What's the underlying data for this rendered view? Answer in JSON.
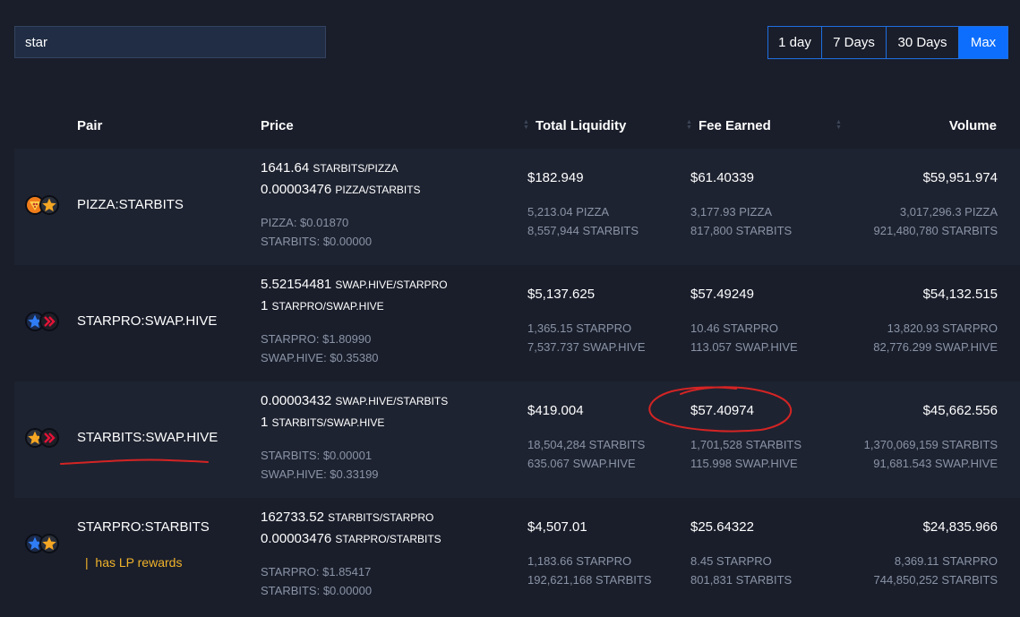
{
  "search": {
    "value": "star"
  },
  "periods": [
    {
      "label": "1 day",
      "active": false
    },
    {
      "label": "7 Days",
      "active": false
    },
    {
      "label": "30 Days",
      "active": false
    },
    {
      "label": "Max",
      "active": true
    }
  ],
  "table": {
    "headers": {
      "pair": "Pair",
      "price": "Price",
      "liquidity": "Total Liquidity",
      "fee": "Fee Earned",
      "volume": "Volume"
    },
    "rows": [
      {
        "pair": "PIZZA:STARBITS",
        "icons": [
          "pizza-token-icon",
          "starbits-token-icon"
        ],
        "lp_rewards": "",
        "price1": {
          "value": "1641.64",
          "unit": "STARBITS/PIZZA"
        },
        "price2": {
          "value": "0.00003476",
          "unit": "PIZZA/STARBITS"
        },
        "usd1": "PIZZA: $0.01870",
        "usd2": "STARBITS: $0.00000",
        "liquidity": "$182.949",
        "liquidity_1": "5,213.04 PIZZA",
        "liquidity_2": "8,557,944 STARBITS",
        "fee": "$61.40339",
        "fee_1": "3,177.93 PIZZA",
        "fee_2": "817,800 STARBITS",
        "volume": "$59,951.974",
        "volume_1": "3,017,296.3 PIZZA",
        "volume_2": "921,480,780 STARBITS"
      },
      {
        "pair": "STARPRO:SWAP.HIVE",
        "icons": [
          "starpro-token-icon",
          "swap-hive-token-icon"
        ],
        "lp_rewards": "",
        "price1": {
          "value": "5.52154481",
          "unit": "SWAP.HIVE/STARPRO"
        },
        "price2": {
          "value": "1",
          "unit": "STARPRO/SWAP.HIVE"
        },
        "usd1": "STARPRO: $1.80990",
        "usd2": "SWAP.HIVE: $0.35380",
        "liquidity": "$5,137.625",
        "liquidity_1": "1,365.15 STARPRO",
        "liquidity_2": "7,537.737 SWAP.HIVE",
        "fee": "$57.49249",
        "fee_1": "10.46 STARPRO",
        "fee_2": "113.057 SWAP.HIVE",
        "volume": "$54,132.515",
        "volume_1": "13,820.93 STARPRO",
        "volume_2": "82,776.299 SWAP.HIVE"
      },
      {
        "pair": "STARBITS:SWAP.HIVE",
        "icons": [
          "starbits-token-icon",
          "swap-hive-token-icon"
        ],
        "lp_rewards": "",
        "price1": {
          "value": "0.00003432",
          "unit": "SWAP.HIVE/STARBITS"
        },
        "price2": {
          "value": "1",
          "unit": "STARBITS/SWAP.HIVE"
        },
        "usd1": "STARBITS: $0.00001",
        "usd2": "SWAP.HIVE: $0.33199",
        "liquidity": "$419.004",
        "liquidity_1": "18,504,284 STARBITS",
        "liquidity_2": "635.067 SWAP.HIVE",
        "fee": "$57.40974",
        "fee_1": "1,701,528 STARBITS",
        "fee_2": "115.998 SWAP.HIVE",
        "volume": "$45,662.556",
        "volume_1": "1,370,069,159 STARBITS",
        "volume_2": "91,681.543 SWAP.HIVE"
      },
      {
        "pair": "STARPRO:STARBITS",
        "icons": [
          "starpro-token-icon",
          "starbits-token-icon"
        ],
        "lp_rewards": "has LP rewards",
        "price1": {
          "value": "162733.52",
          "unit": "STARBITS/STARPRO"
        },
        "price2": {
          "value": "0.00003476",
          "unit": "STARPRO/STARBITS"
        },
        "usd1": "STARPRO: $1.85417",
        "usd2": "STARBITS: $0.00000",
        "liquidity": "$4,507.01",
        "liquidity_1": "1,183.66 STARPRO",
        "liquidity_2": "192,621,168 STARBITS",
        "fee": "$25.64322",
        "fee_1": "8.45 STARPRO",
        "fee_2": "801,831 STARBITS",
        "volume": "$24,835.966",
        "volume_1": "8,369.11 STARPRO",
        "volume_2": "744,850,252 STARBITS"
      }
    ]
  },
  "colors": {
    "background": "#1a1e2b",
    "row_alt": "#1e2331",
    "accent": "#0d6efd",
    "lp_rewards": "#f0b32a",
    "annotation": "#d42424"
  }
}
